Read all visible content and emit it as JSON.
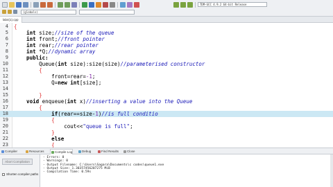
{
  "toolbar": {
    "function_combo": "(globals)",
    "compiler_combo": "TDM-GCC 4.9.2 64-bit Release"
  },
  "file_tab": {
    "label": "lab4(1).cpp"
  },
  "editor": {
    "current_line": 18,
    "lines": [
      {
        "n": "4",
        "code": [
          {
            "t": "{",
            "c": "br"
          }
        ]
      },
      {
        "n": "5",
        "code": [
          {
            "t": "    int ",
            "c": "kw"
          },
          {
            "t": "size;",
            "c": "pl"
          },
          {
            "t": "//size of the queue",
            "c": "cmt"
          }
        ]
      },
      {
        "n": "6",
        "code": [
          {
            "t": "    int ",
            "c": "kw"
          },
          {
            "t": "front;",
            "c": "pl"
          },
          {
            "t": "//front pointer",
            "c": "cmt"
          }
        ]
      },
      {
        "n": "7",
        "code": [
          {
            "t": "    int ",
            "c": "kw"
          },
          {
            "t": "rear;",
            "c": "pl"
          },
          {
            "t": "//rear pointer",
            "c": "cmt"
          }
        ]
      },
      {
        "n": "8",
        "code": [
          {
            "t": "    int ",
            "c": "kw"
          },
          {
            "t": "*Q;",
            "c": "pl"
          },
          {
            "t": "//dynamic array",
            "c": "cmt"
          }
        ]
      },
      {
        "n": "9",
        "code": [
          {
            "t": "    public:",
            "c": "kw"
          }
        ]
      },
      {
        "n": "10",
        "code": [
          {
            "t": "        Queue(",
            "c": "pl"
          },
          {
            "t": "int ",
            "c": "kw"
          },
          {
            "t": "size):size(size)",
            "c": "pl"
          },
          {
            "t": "//parameterised constructor",
            "c": "cmt"
          }
        ]
      },
      {
        "n": "11",
        "code": [
          {
            "t": "        {",
            "c": "br"
          }
        ]
      },
      {
        "n": "12",
        "code": [
          {
            "t": "            front=rear=",
            "c": "pl"
          },
          {
            "t": "-1",
            "c": "num"
          },
          {
            "t": ";",
            "c": "pl"
          }
        ]
      },
      {
        "n": "13",
        "code": [
          {
            "t": "            Q=",
            "c": "pl"
          },
          {
            "t": "new int",
            "c": "kw"
          },
          {
            "t": "[size];",
            "c": "pl"
          }
        ]
      },
      {
        "n": "14",
        "code": []
      },
      {
        "n": "15",
        "code": [
          {
            "t": "        }",
            "c": "br"
          }
        ]
      },
      {
        "n": "16",
        "code": [
          {
            "t": "    void ",
            "c": "kw"
          },
          {
            "t": "enqueue(",
            "c": "pl"
          },
          {
            "t": "int ",
            "c": "kw"
          },
          {
            "t": "x)",
            "c": "pl"
          },
          {
            "t": "//inserting a value into the Queue",
            "c": "cmt"
          }
        ]
      },
      {
        "n": "17",
        "code": [
          {
            "t": "        {",
            "c": "br"
          }
        ]
      },
      {
        "n": "18",
        "code": [
          {
            "t": "            if",
            "c": "kw"
          },
          {
            "t": "(rear==size-",
            "c": "pl"
          },
          {
            "t": "1",
            "c": "num"
          },
          {
            "t": ")",
            "c": "pl"
          },
          {
            "t": "//is full conditio",
            "c": "cmt"
          }
        ]
      },
      {
        "n": "19",
        "code": [
          {
            "t": "            {",
            "c": "br"
          }
        ]
      },
      {
        "n": "20",
        "code": [
          {
            "t": "                cout<<",
            "c": "pl"
          },
          {
            "t": "\"queue is full\"",
            "c": "str"
          },
          {
            "t": ";",
            "c": "pl"
          }
        ]
      },
      {
        "n": "21",
        "code": [
          {
            "t": "            }",
            "c": "br"
          }
        ]
      },
      {
        "n": "22",
        "code": [
          {
            "t": "            else",
            "c": "kw"
          }
        ]
      },
      {
        "n": "23",
        "code": [
          {
            "t": "            {",
            "c": "br"
          }
        ]
      }
    ]
  },
  "report_tabs": [
    {
      "label": "Compiler",
      "icon": "compiler-icon",
      "color": "#5b8dd9"
    },
    {
      "label": "Resources",
      "icon": "resources-icon",
      "color": "#d9a441"
    },
    {
      "label": "Compile Log",
      "icon": "compile-log-icon",
      "color": "#6aaa5c"
    },
    {
      "label": "Debug",
      "icon": "debug-icon",
      "color": "#5aa0c8"
    },
    {
      "label": "Find Results",
      "icon": "find-results-icon",
      "color": "#c85a5a"
    },
    {
      "label": "Close",
      "icon": "close-icon",
      "color": "#999999"
    }
  ],
  "bottom_panel": {
    "abort_label": "Abort Compilation",
    "shorten_label": "Shorten compiler paths",
    "log_lines": [
      "- Errors: 0",
      "- Warnings: 0",
      "- Output Filename: C:\\Users\\Sagara\\Documents\\c codes\\queue1.exe",
      "- Output Size: 1.30357456207275 MiB",
      "- Compilation Time: 0.59s"
    ]
  }
}
